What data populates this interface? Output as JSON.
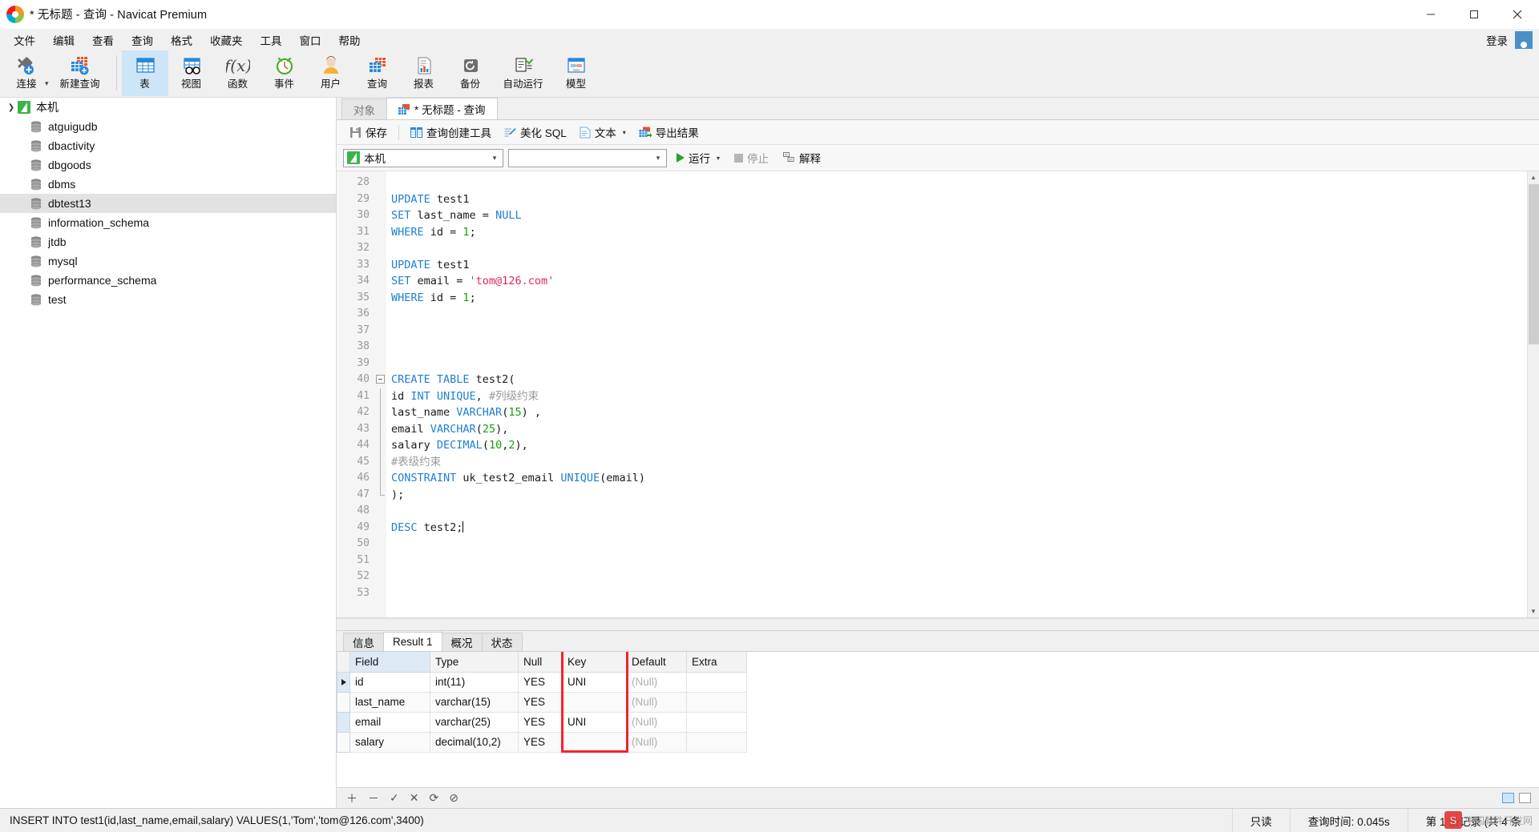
{
  "window": {
    "title": "* 无标题 - 查询 - Navicat Premium",
    "minimize": "–",
    "maximize": "□",
    "close": "✕"
  },
  "menubar": {
    "items": [
      "文件",
      "编辑",
      "查看",
      "查询",
      "格式",
      "收藏夹",
      "工具",
      "窗口",
      "帮助"
    ],
    "login": "登录"
  },
  "toolbar": {
    "items": [
      {
        "label": "连接",
        "icon": "connection-icon"
      },
      {
        "label": "新建查询",
        "icon": "new-query-icon"
      },
      {
        "label": "表",
        "icon": "table-icon"
      },
      {
        "label": "视图",
        "icon": "view-icon"
      },
      {
        "label": "函数",
        "icon": "function-icon"
      },
      {
        "label": "事件",
        "icon": "event-icon"
      },
      {
        "label": "用户",
        "icon": "user-icon"
      },
      {
        "label": "查询",
        "icon": "query-icon"
      },
      {
        "label": "报表",
        "icon": "report-icon"
      },
      {
        "label": "备份",
        "icon": "backup-icon"
      },
      {
        "label": "自动运行",
        "icon": "automation-icon"
      },
      {
        "label": "模型",
        "icon": "model-icon"
      }
    ],
    "active_label": "表"
  },
  "sidebar": {
    "connection": "本机",
    "databases": [
      "atguigudb",
      "dbactivity",
      "dbgoods",
      "dbms",
      "dbtest13",
      "information_schema",
      "jtdb",
      "mysql",
      "performance_schema",
      "test"
    ],
    "selected": "dbtest13"
  },
  "tabs": [
    {
      "label": "对象",
      "active": false
    },
    {
      "label": "* 无标题 - 查询",
      "active": true
    }
  ],
  "query_toolbar": {
    "save": "保存",
    "query_builder": "查询创建工具",
    "beautify_sql": "美化 SQL",
    "text": "文本",
    "export_result": "导出结果"
  },
  "run_toolbar": {
    "connection_value": "本机",
    "database_value": "",
    "run": "运行",
    "stop": "停止",
    "explain": "解释"
  },
  "editor": {
    "first_line": 28,
    "lines": [
      {
        "n": 28,
        "tokens": []
      },
      {
        "n": 29,
        "tokens": [
          {
            "t": "UPDATE",
            "c": "kw"
          },
          {
            "t": " test1",
            "c": ""
          }
        ]
      },
      {
        "n": 30,
        "tokens": [
          {
            "t": "SET",
            "c": "kw"
          },
          {
            "t": " last_name = ",
            "c": ""
          },
          {
            "t": "NULL",
            "c": "kw"
          }
        ]
      },
      {
        "n": 31,
        "tokens": [
          {
            "t": "WHERE",
            "c": "kw"
          },
          {
            "t": " id = ",
            "c": ""
          },
          {
            "t": "1",
            "c": "num"
          },
          {
            "t": ";",
            "c": ""
          }
        ]
      },
      {
        "n": 32,
        "tokens": []
      },
      {
        "n": 33,
        "tokens": [
          {
            "t": "UPDATE",
            "c": "kw"
          },
          {
            "t": " test1",
            "c": ""
          }
        ]
      },
      {
        "n": 34,
        "tokens": [
          {
            "t": "SET",
            "c": "kw"
          },
          {
            "t": " email = ",
            "c": ""
          },
          {
            "t": "'tom@126.com'",
            "c": "str"
          }
        ]
      },
      {
        "n": 35,
        "tokens": [
          {
            "t": "WHERE",
            "c": "kw"
          },
          {
            "t": " id = ",
            "c": ""
          },
          {
            "t": "1",
            "c": "num"
          },
          {
            "t": ";",
            "c": ""
          }
        ]
      },
      {
        "n": 36,
        "tokens": []
      },
      {
        "n": 37,
        "tokens": []
      },
      {
        "n": 38,
        "tokens": []
      },
      {
        "n": 39,
        "tokens": []
      },
      {
        "n": 40,
        "fold": "start",
        "tokens": [
          {
            "t": "CREATE TABLE",
            "c": "kw"
          },
          {
            "t": " test2(",
            "c": ""
          }
        ]
      },
      {
        "n": 41,
        "fold": "mid",
        "tokens": [
          {
            "t": "id ",
            "c": ""
          },
          {
            "t": "INT UNIQUE",
            "c": "kw"
          },
          {
            "t": ", ",
            "c": ""
          },
          {
            "t": "#列级约束",
            "c": "cmt"
          }
        ]
      },
      {
        "n": 42,
        "fold": "mid",
        "tokens": [
          {
            "t": "last_name ",
            "c": ""
          },
          {
            "t": "VARCHAR",
            "c": "kw"
          },
          {
            "t": "(",
            "c": ""
          },
          {
            "t": "15",
            "c": "num"
          },
          {
            "t": ") ,",
            "c": ""
          }
        ]
      },
      {
        "n": 43,
        "fold": "mid",
        "tokens": [
          {
            "t": "email ",
            "c": ""
          },
          {
            "t": "VARCHAR",
            "c": "kw"
          },
          {
            "t": "(",
            "c": ""
          },
          {
            "t": "25",
            "c": "num"
          },
          {
            "t": "),",
            "c": ""
          }
        ]
      },
      {
        "n": 44,
        "fold": "mid",
        "tokens": [
          {
            "t": "salary ",
            "c": ""
          },
          {
            "t": "DECIMAL",
            "c": "kw"
          },
          {
            "t": "(",
            "c": ""
          },
          {
            "t": "10",
            "c": "num"
          },
          {
            "t": ",",
            "c": ""
          },
          {
            "t": "2",
            "c": "num"
          },
          {
            "t": "),",
            "c": ""
          }
        ]
      },
      {
        "n": 45,
        "fold": "mid",
        "tokens": [
          {
            "t": "#表级约束",
            "c": "cmt"
          }
        ]
      },
      {
        "n": 46,
        "fold": "mid",
        "tokens": [
          {
            "t": "CONSTRAINT",
            "c": "kw"
          },
          {
            "t": " uk_test2_email ",
            "c": ""
          },
          {
            "t": "UNIQUE",
            "c": "kw"
          },
          {
            "t": "(email)",
            "c": ""
          }
        ]
      },
      {
        "n": 47,
        "fold": "end",
        "tokens": [
          {
            "t": ");",
            "c": ""
          }
        ]
      },
      {
        "n": 48,
        "tokens": []
      },
      {
        "n": 49,
        "tokens": [
          {
            "t": "DESC",
            "c": "kw"
          },
          {
            "t": " test2;",
            "c": ""
          }
        ],
        "caret": true
      },
      {
        "n": 50,
        "tokens": []
      },
      {
        "n": 51,
        "tokens": []
      },
      {
        "n": 52,
        "tokens": []
      },
      {
        "n": 53,
        "tokens": []
      }
    ]
  },
  "results": {
    "tabs": [
      {
        "label": "信息",
        "active": false
      },
      {
        "label": "Result 1",
        "active": true
      },
      {
        "label": "概况",
        "active": false
      },
      {
        "label": "状态",
        "active": false
      }
    ],
    "columns": [
      "Field",
      "Type",
      "Null",
      "Key",
      "Default",
      "Extra"
    ],
    "rows": [
      {
        "current": true,
        "cells": [
          "id",
          "int(11)",
          "YES",
          "UNI",
          "(Null)",
          ""
        ]
      },
      {
        "current": false,
        "cells": [
          "last_name",
          "varchar(15)",
          "YES",
          "",
          "(Null)",
          ""
        ]
      },
      {
        "current": false,
        "cells": [
          "email",
          "varchar(25)",
          "YES",
          "UNI",
          "(Null)",
          ""
        ]
      },
      {
        "current": false,
        "cells": [
          "salary",
          "decimal(10,2)",
          "YES",
          "",
          "(Null)",
          ""
        ]
      }
    ],
    "null_text": "(Null)",
    "highlight_color": "#f5222d",
    "footer_icons": [
      "add-row-icon",
      "remove-row-icon",
      "apply-icon",
      "cancel-icon",
      "refresh-icon",
      "stop-icon"
    ]
  },
  "statusbar": {
    "sql": "INSERT INTO test1(id,last_name,email,salary) VALUES(1,'Tom','tom@126.com',3400)",
    "readonly": "只读",
    "query_time": "查询时间: 0.045s",
    "record_info": "第 1 条记录 (共 4 条"
  },
  "watermark": {
    "mark": "S",
    "text": "中国软件开发网"
  }
}
